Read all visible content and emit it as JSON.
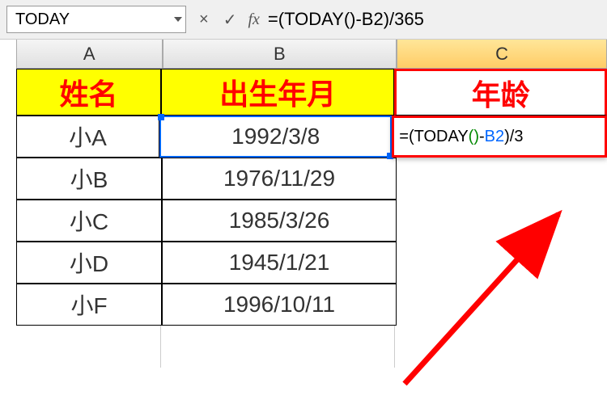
{
  "formula_bar": {
    "name_box": "TODAY",
    "cancel": "×",
    "confirm": "✓",
    "fx": "fx",
    "formula": "=(TODAY()-B2)/365"
  },
  "columns": {
    "a": "A",
    "b": "B",
    "c": "C"
  },
  "headers": {
    "name": "姓名",
    "birthdate": "出生年月",
    "age": "年龄"
  },
  "rows": [
    {
      "name": "小A",
      "birthdate": "1992/3/8"
    },
    {
      "name": "小B",
      "birthdate": "1976/11/29"
    },
    {
      "name": "小C",
      "birthdate": "1985/3/26"
    },
    {
      "name": "小D",
      "birthdate": "1945/1/21"
    },
    {
      "name": "小F",
      "birthdate": "1996/10/11"
    }
  ],
  "editing_cell": {
    "prefix": "=(TODAY",
    "paren": "()",
    "mid": "-",
    "ref": "B2",
    "suffix": ")/3"
  }
}
